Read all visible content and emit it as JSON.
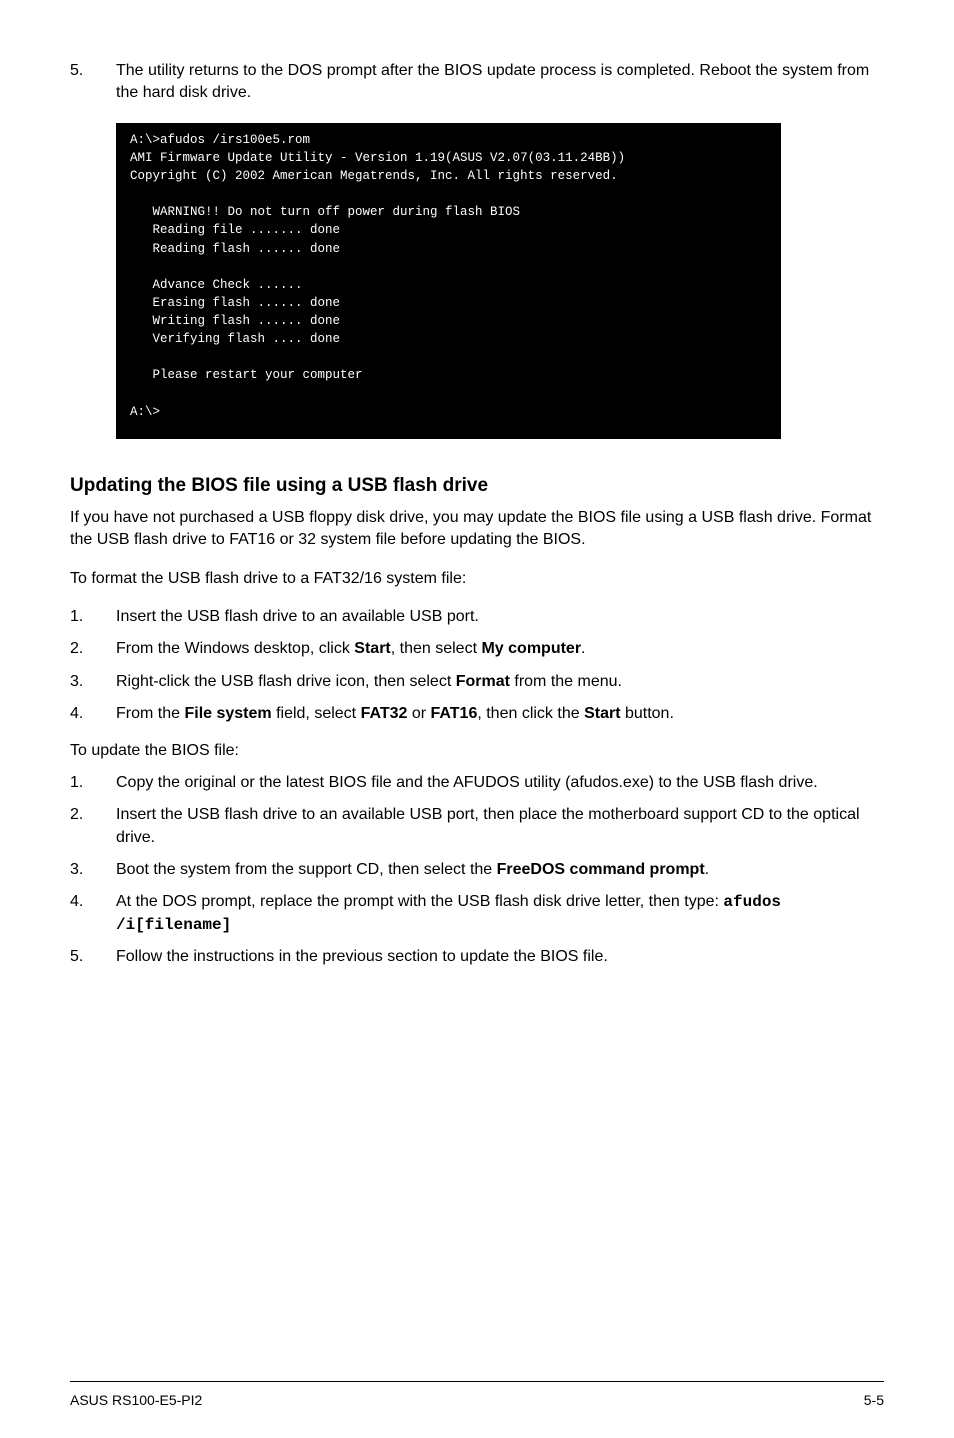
{
  "step5": {
    "num": "5.",
    "text": "The utility returns to the DOS prompt after the BIOS update process is completed. Reboot the system from the hard disk drive."
  },
  "terminal": "A:\\>afudos /irs100e5.rom\nAMI Firmware Update Utility - Version 1.19(ASUS V2.07(03.11.24BB))\nCopyright (C) 2002 American Megatrends, Inc. All rights reserved.\n\n   WARNING!! Do not turn off power during flash BIOS\n   Reading file ....... done\n   Reading flash ...... done\n\n   Advance Check ......\n   Erasing flash ...... done\n   Writing flash ...... done\n   Verifying flash .... done\n\n   Please restart your computer\n\nA:\\>",
  "section_heading": "Updating the BIOS file using a USB flash drive",
  "intro_para": "If you have not purchased a USB floppy disk drive, you may update the BIOS file using a USB flash drive. Format the USB flash drive to FAT16 or 32 system file before updating the BIOS.",
  "format_lead": "To format the USB flash drive to a FAT32/16 system file:",
  "format_steps": [
    {
      "num": "1.",
      "text": "Insert the USB flash drive to an available USB port."
    },
    {
      "num": "2.",
      "prefix": "From the Windows desktop, click ",
      "b1": "Start",
      "mid": ", then select ",
      "b2": "My computer",
      "suffix": "."
    },
    {
      "num": "3.",
      "prefix": "Right-click the USB flash drive icon, then select ",
      "b1": "Format",
      "suffix": " from the menu."
    },
    {
      "num": "4.",
      "prefix": "From the ",
      "b1": "File system",
      "mid1": " field, select ",
      "b2": "FAT32",
      "mid2": " or ",
      "b3": "FAT16",
      "mid3": ", then click the ",
      "b4": "Start",
      "suffix": " button."
    }
  ],
  "update_lead": "To update the BIOS file:",
  "update_steps": [
    {
      "num": "1.",
      "text": "Copy the original or the latest BIOS file and the AFUDOS utility (afudos.exe) to the USB flash drive."
    },
    {
      "num": "2.",
      "text": "Insert the USB flash drive to an available USB port, then place the motherboard support CD to the optical drive."
    },
    {
      "num": "3.",
      "prefix": "Boot the system from the support CD, then select the ",
      "b1": "FreeDOS command prompt",
      "suffix": "."
    },
    {
      "num": "4.",
      "prefix": "At the DOS prompt, replace the prompt with the USB flash disk drive letter, then type: ",
      "code": "afudos /i[filename]"
    },
    {
      "num": "5.",
      "text": "Follow the instructions in the previous section to update the BIOS file."
    }
  ],
  "footer_left": "ASUS RS100-E5-PI2",
  "footer_right": "5-5"
}
